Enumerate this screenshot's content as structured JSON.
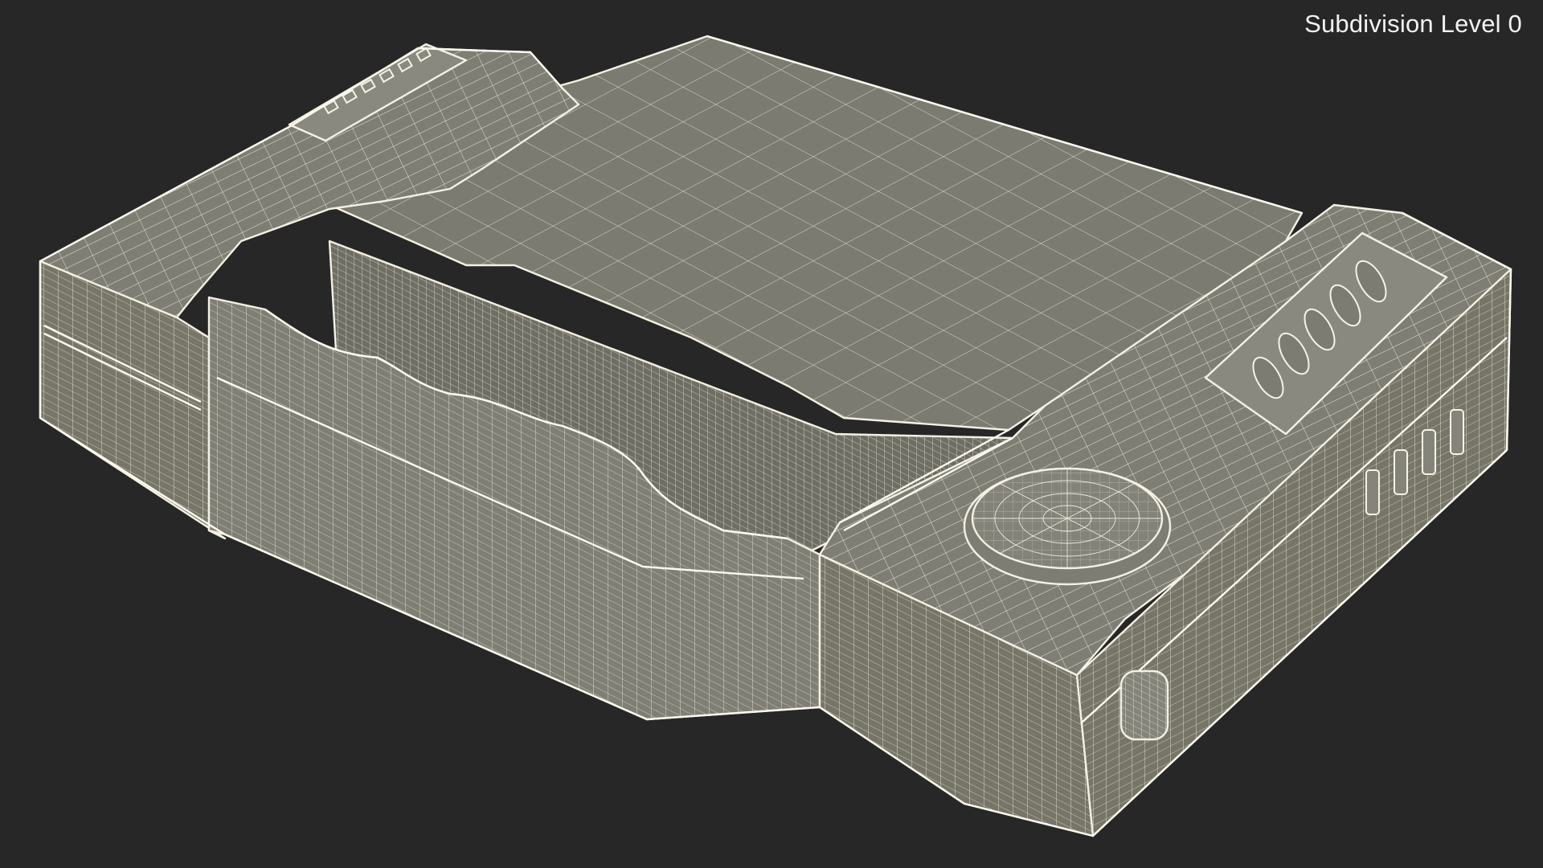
{
  "viewport": {
    "background_color": "#272727",
    "mesh_face_color": "#7d7c72",
    "mesh_wire_color": "#ece9dc",
    "label": "Subdivision Level 0"
  },
  "model": {
    "description_icon": "wireframe-case-icon"
  }
}
